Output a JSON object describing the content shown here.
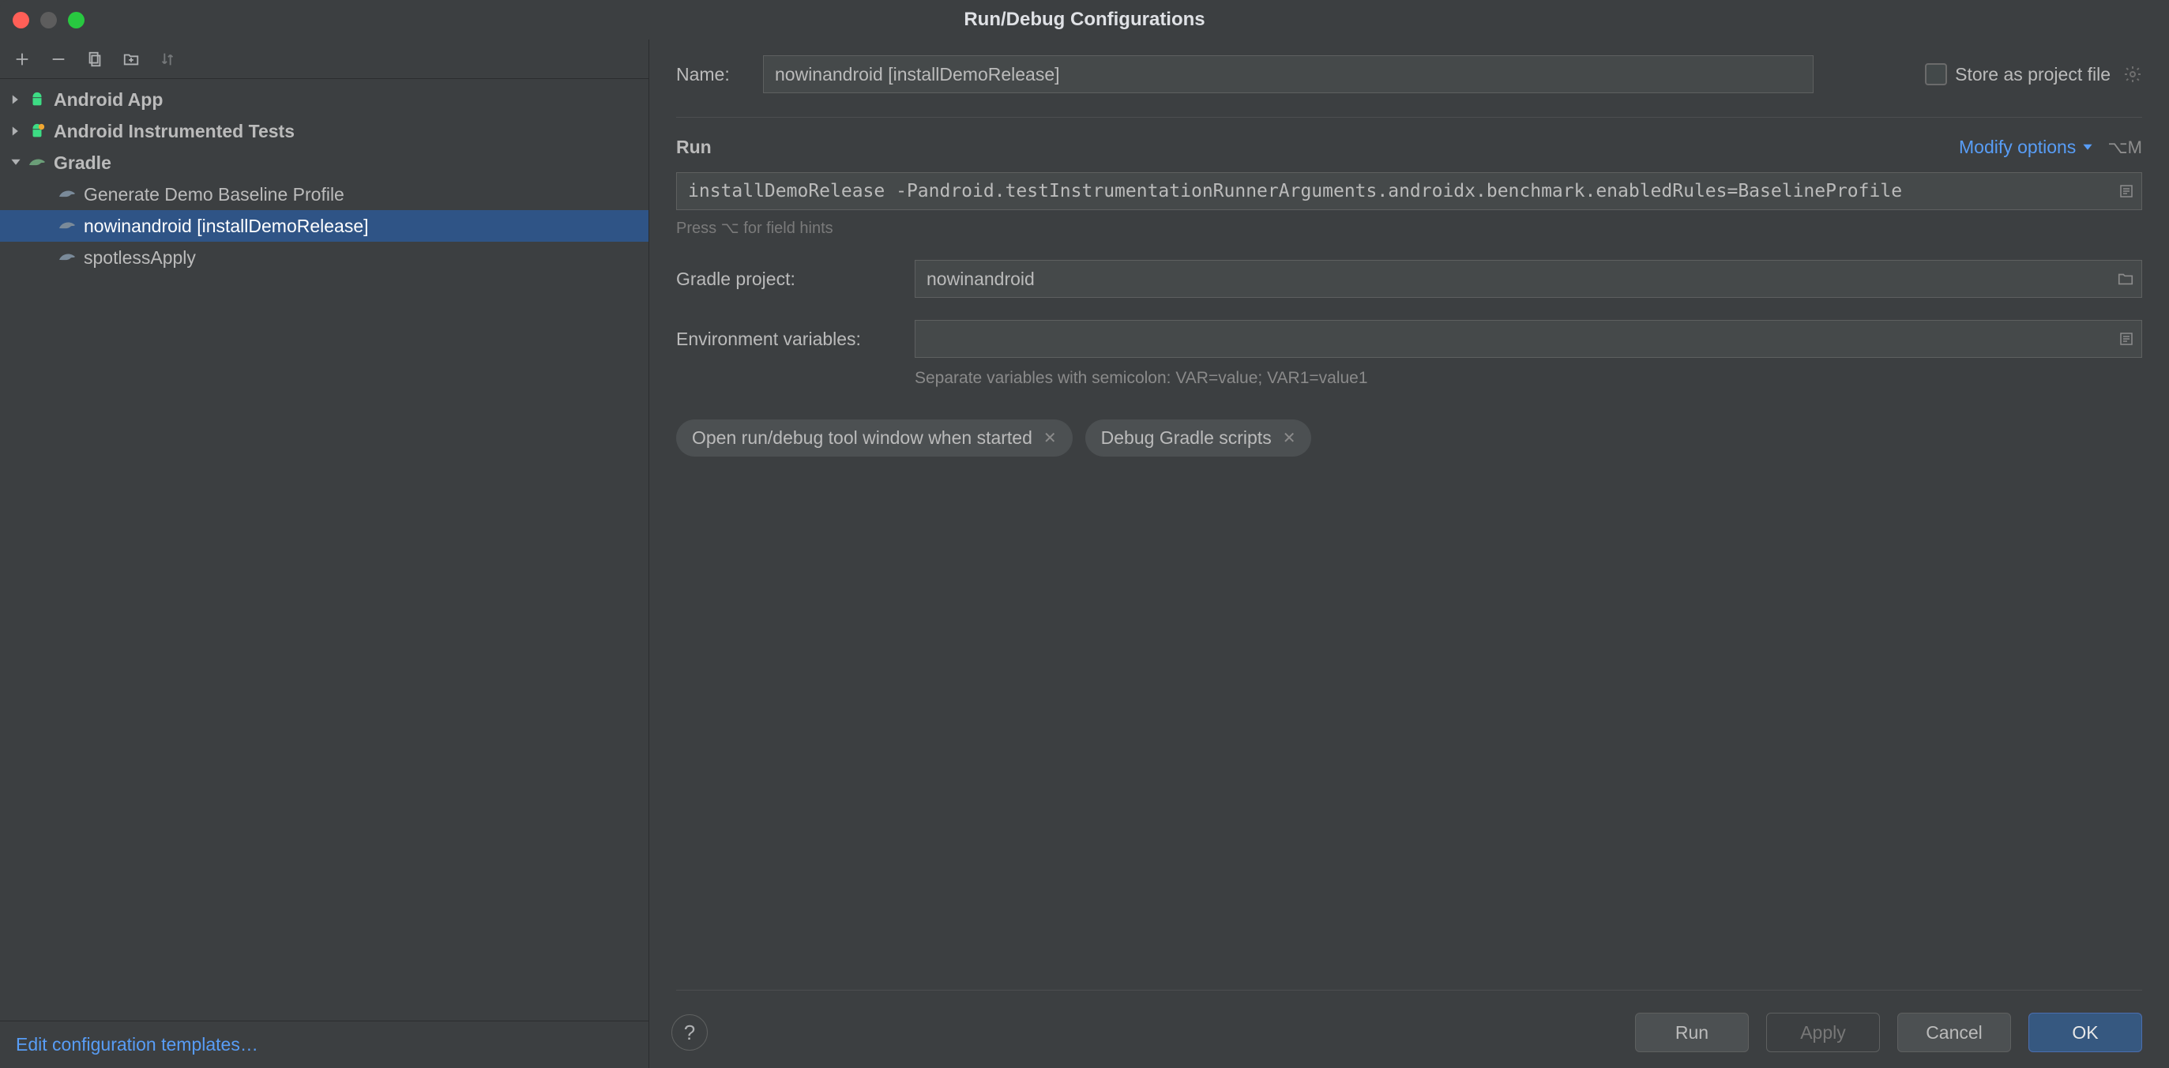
{
  "title": "Run/Debug Configurations",
  "toolbar": {
    "add": "＋",
    "remove": "−",
    "copy": "⎘",
    "folder": "📁",
    "sort": "↕"
  },
  "tree": {
    "nodes": [
      {
        "label": "Android App",
        "expanded": false,
        "type": "android"
      },
      {
        "label": "Android Instrumented Tests",
        "expanded": false,
        "type": "android-test"
      },
      {
        "label": "Gradle",
        "expanded": true,
        "type": "gradle",
        "children": [
          {
            "label": "Generate Demo Baseline Profile",
            "selected": false
          },
          {
            "label": "nowinandroid [installDemoRelease]",
            "selected": true
          },
          {
            "label": "spotlessApply",
            "selected": false
          }
        ]
      }
    ]
  },
  "sidebar_footer": {
    "edit_templates": "Edit configuration templates…"
  },
  "form": {
    "name_label": "Name:",
    "name_value": "nowinandroid [installDemoRelease]",
    "store_as_project_file": "Store as project file",
    "run_section": "Run",
    "modify_options": "Modify options",
    "modify_shortcut": "⌥M",
    "tasks_value": "installDemoRelease -Pandroid.testInstrumentationRunnerArguments.androidx.benchmark.enabledRules=BaselineProfile",
    "tasks_hint": "Press ⌥ for field hints",
    "gradle_project_label": "Gradle project:",
    "gradle_project_value": "nowinandroid",
    "env_label": "Environment variables:",
    "env_value": "",
    "env_hint": "Separate variables with semicolon: VAR=value; VAR1=value1",
    "chips": [
      "Open run/debug tool window when started",
      "Debug Gradle scripts"
    ]
  },
  "footer": {
    "help": "?",
    "run": "Run",
    "apply": "Apply",
    "cancel": "Cancel",
    "ok": "OK"
  }
}
